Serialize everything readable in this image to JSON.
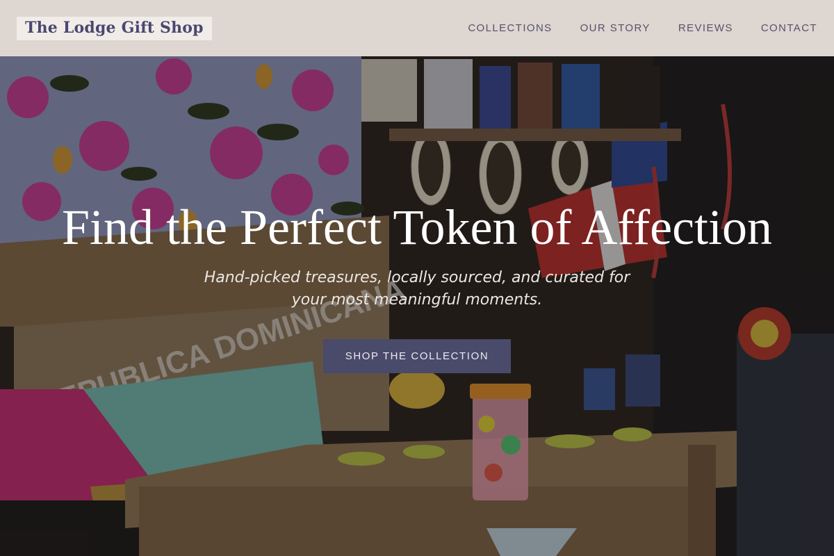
{
  "header": {
    "logo": "The Lodge Gift Shop",
    "nav": [
      {
        "label": "COLLECTIONS"
      },
      {
        "label": "OUR STORY"
      },
      {
        "label": "REVIEWS"
      },
      {
        "label": "CONTACT"
      }
    ]
  },
  "hero": {
    "title": "Find the Perfect Token of Affection",
    "subtitle": "Hand-picked treasures, locally sourced, and curated for your most meaningful moments.",
    "cta_label": "SHOP THE COLLECTION",
    "background_description_icon": "market-stall-photo",
    "background_text": "REPUBLICA DOMINICANA"
  },
  "colors": {
    "brand": "#4a4870",
    "cta_bg": "#4a4a6a",
    "header_bg": "#ece4e0"
  }
}
